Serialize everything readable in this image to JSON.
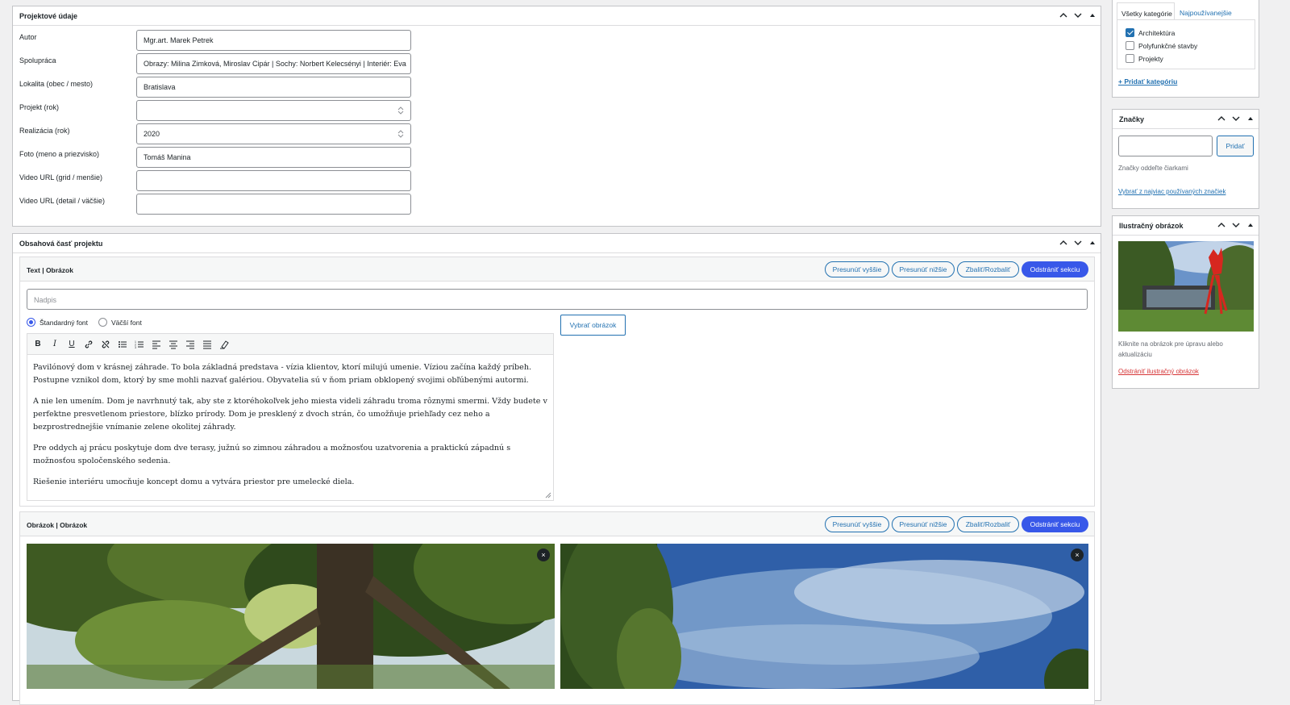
{
  "project_panel": {
    "title": "Projektové údaje",
    "fields": [
      {
        "label": "Autor",
        "value": "Mgr.art. Marek Petrek"
      },
      {
        "label": "Spolupráca",
        "value": "Obrazy: Milina Zimková, Miroslav Cipár | Sochy: Norbert Kelecsényi | Interiér: Eva"
      },
      {
        "label": "Lokalita (obec / mesto)",
        "value": "Bratislava"
      },
      {
        "label": "Projekt (rok)",
        "value": ""
      },
      {
        "label": "Realizácia (rok)",
        "value": "2020"
      },
      {
        "label": "Foto (meno a priezvisko)",
        "value": "Tomáš Manina"
      },
      {
        "label": "Video URL (grid / menšie)",
        "value": ""
      },
      {
        "label": "Video URL (detail / väčšie)",
        "value": ""
      }
    ]
  },
  "content_panel": {
    "title": "Obsahová časť projektu",
    "section_buttons": {
      "move_up": "Presunúť vyššie",
      "move_down": "Presunúť nižšie",
      "collapse": "Zbaliť/Rozbaliť",
      "remove": "Odstrániť sekciu"
    },
    "section1": {
      "title": "Text | Obrázok",
      "heading_placeholder": "Nadpis",
      "font_standard": "Štandardný font",
      "font_larger": "Väčší font",
      "choose_image": "Vybrať obrázok",
      "paragraphs": [
        "Pavilónový dom v krásnej záhrade. To bola základná predstava - vízia klientov, ktorí milujú umenie. Víziou začína každý príbeh. Postupne vznikol dom, ktorý by sme mohli nazvať galériou. Obyvatelia sú v ňom priam obklopený svojimi obľúbenými autormi.",
        "A nie len umením. Dom je navrhnutý tak, aby ste z ktoréhokoľvek jeho miesta videli záhradu troma rôznymi smermi. Vždy budete v perfektne presvetlenom priestore, blízko prírody. Dom je presklený z dvoch strán, čo umožňuje priehľady cez neho a bezprostrednejšie vnímanie zelene okolitej záhrady.",
        "Pre oddych aj prácu poskytuje dom dve terasy, južnú so zimnou záhradou a možnosťou uzatvorenia a praktickú západnú s možnosťou spoločenského sedenia.",
        "Riešenie interiéru umocňuje koncept domu a vytvára priestor pre umelecké diela."
      ]
    },
    "section2": {
      "title": "Obrázok | Obrázok",
      "close_glyph": "×"
    }
  },
  "categories": {
    "tab_all": "Všetky kategórie",
    "tab_popular": "Najpoužívanejšie",
    "items": [
      {
        "label": "Architektúra",
        "checked": true
      },
      {
        "label": "Polyfunkčné stavby",
        "checked": false
      },
      {
        "label": "Projekty",
        "checked": false
      }
    ],
    "add_link": "+ Pridať kategóriu"
  },
  "tags": {
    "title": "Značky",
    "add_button": "Pridať",
    "hint": "Značky oddeľte čiarkami",
    "choose_link": "Vybrať z najviac používaných značiek"
  },
  "featured_image": {
    "title": "Ilustračný obrázok",
    "hint": "Kliknite na obrázok pre úpravu alebo aktualizáciu",
    "remove_link": "Odstrániť ilustračný obrázok"
  },
  "colors": {
    "accent": "#3858e9",
    "link": "#2271b1",
    "danger": "#d63638"
  }
}
